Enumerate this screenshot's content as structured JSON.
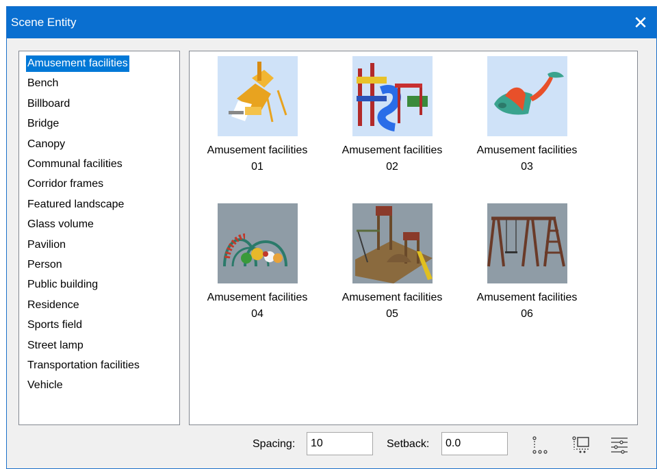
{
  "window": {
    "title": "Scene Entity",
    "close_glyph": "✕"
  },
  "categories": [
    "Amusement facilities",
    "Bench",
    "Billboard",
    "Bridge",
    "Canopy",
    "Communal facilities",
    "Corridor frames",
    "Featured landscape",
    "Glass volume",
    "Pavilion",
    "Person",
    "Public building",
    "Residence",
    "Sports field",
    "Street lamp",
    "Transportation facilities",
    "Vehicle"
  ],
  "selected_category": "Amusement facilities",
  "entities": [
    {
      "name_line1": "Amusement facilities",
      "name_line2": "01",
      "thumb_bg": "#cfe2f8"
    },
    {
      "name_line1": "Amusement facilities",
      "name_line2": "02",
      "thumb_bg": "#cfe2f8"
    },
    {
      "name_line1": "Amusement facilities",
      "name_line2": "03",
      "thumb_bg": "#cfe2f8"
    },
    {
      "name_line1": "Amusement facilities",
      "name_line2": "04",
      "thumb_bg": "#8f9ca6"
    },
    {
      "name_line1": "Amusement facilities",
      "name_line2": "05",
      "thumb_bg": "#8f9ca6"
    },
    {
      "name_line1": "Amusement facilities",
      "name_line2": "06",
      "thumb_bg": "#8f9ca6"
    }
  ],
  "footer": {
    "spacing_label": "Spacing:",
    "spacing_value": "10",
    "setback_label": "Setback:",
    "setback_value": "0.0",
    "icons": [
      "vertical-spacing-icon",
      "place-entity-icon",
      "distribute-settings-icon"
    ]
  },
  "colors": {
    "titlebar": "#0a6fd0",
    "selection": "#0078d7"
  }
}
